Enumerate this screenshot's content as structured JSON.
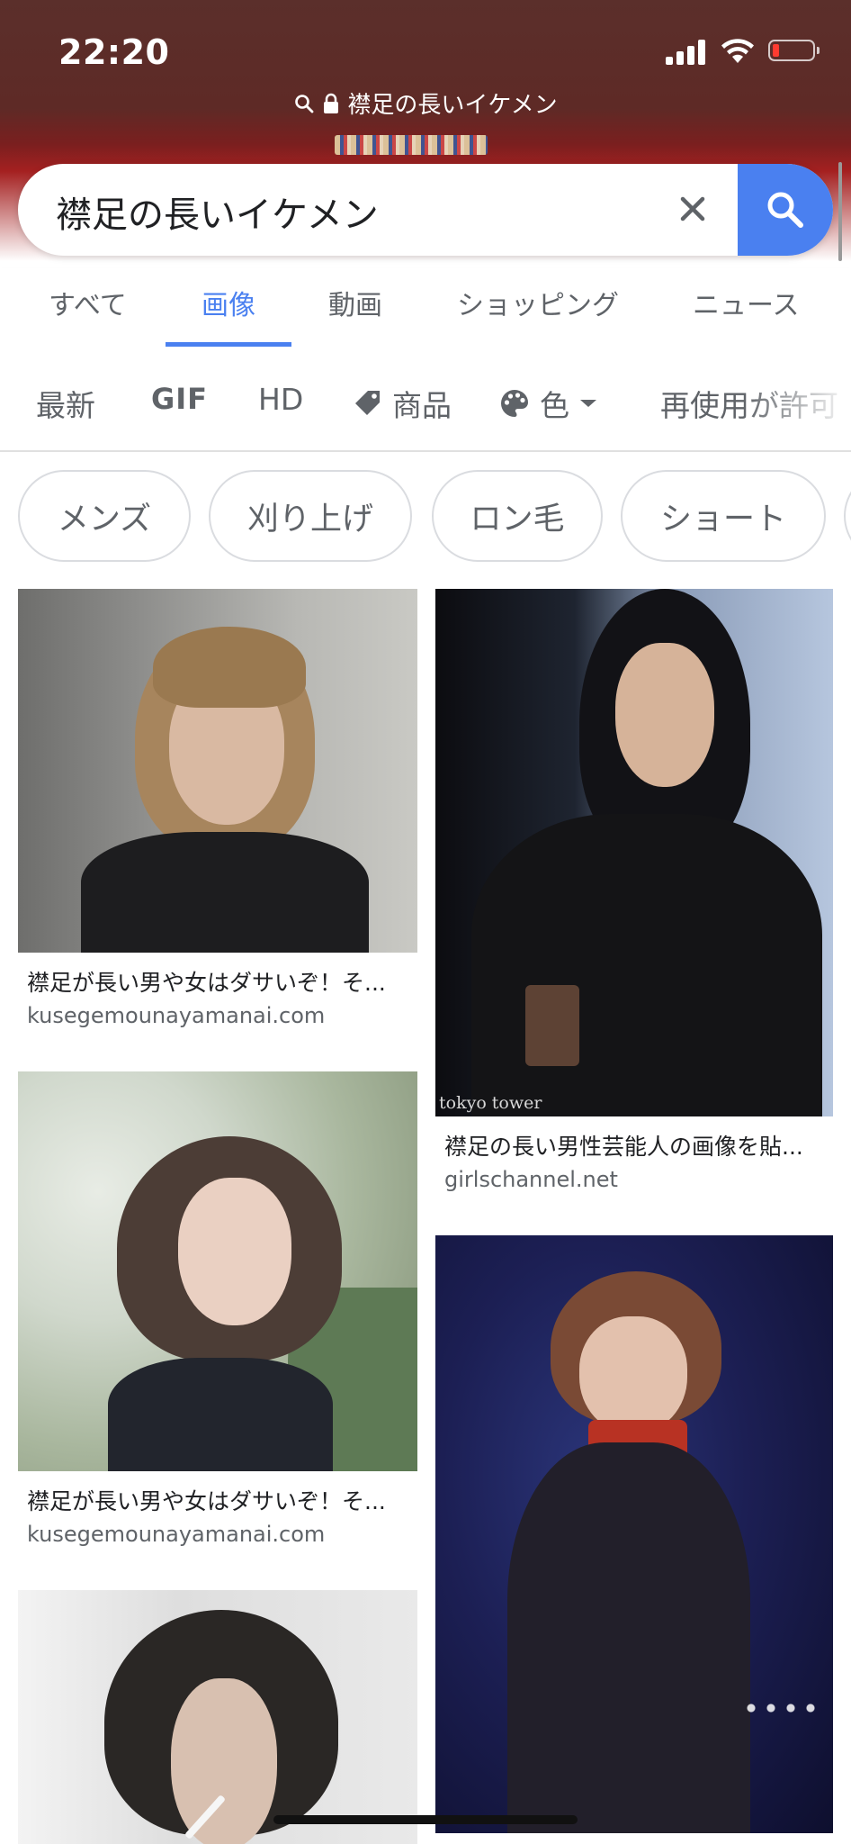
{
  "status_bar": {
    "time": "22:20",
    "icons": [
      "signal-icon",
      "wifi-icon",
      "battery-low-icon"
    ]
  },
  "browser": {
    "url_text": "襟足の長いイケメン",
    "url_icons": [
      "search-icon",
      "lock-icon"
    ]
  },
  "search": {
    "query": "襟足の長いイケメン",
    "clear_icon": "close-icon",
    "submit_icon": "search-icon"
  },
  "tabs": [
    {
      "label": "すべて",
      "active": false
    },
    {
      "label": "画像",
      "active": true
    },
    {
      "label": "動画",
      "active": false
    },
    {
      "label": "ショッピング",
      "active": false
    },
    {
      "label": "ニュース",
      "active": false
    }
  ],
  "filters": {
    "latest": "最新",
    "gif": "GIF",
    "hd": "HD",
    "products": "商品",
    "color": "色",
    "reuse": "再使用が許可"
  },
  "chips": [
    "メンズ",
    "刈り上げ",
    "ロン毛",
    "ショート"
  ],
  "results": [
    {
      "caption": "襟足が長い男や女はダサいぞ！そ...",
      "source": "kusegemounayamanai.com"
    },
    {
      "caption": "襟足の長い男性芸能人の画像を貼...",
      "source": "girlschannel.net",
      "watermark": "tokyo tower"
    },
    {
      "caption": "襟足が長い男や女はダサいぞ！そ...",
      "source": "kusegemounayamanai.com"
    },
    {
      "caption": "",
      "source": ""
    },
    {
      "caption": "",
      "source": ""
    }
  ],
  "colors": {
    "accent": "#4a80f0",
    "header_dark": "#5b2f2b",
    "header_red": "#a42020"
  }
}
